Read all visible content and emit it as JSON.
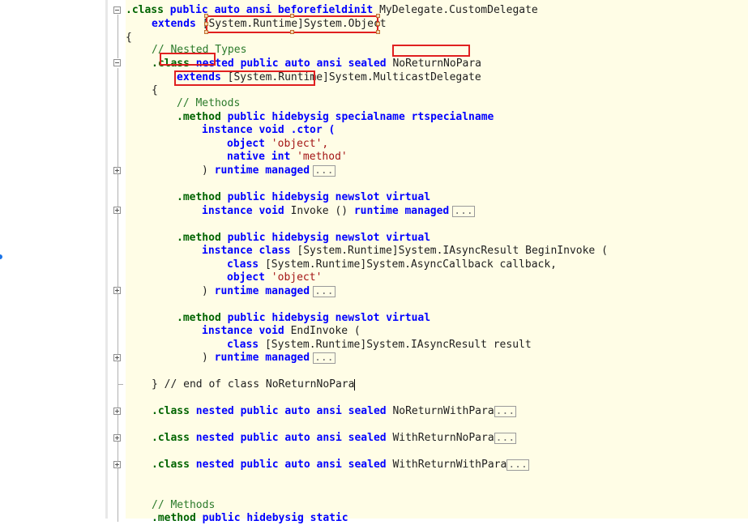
{
  "code": {
    "class_header": {
      "kw": ".class",
      "mods": "public auto ansi beforefieldinit",
      "name": "MyDelegate.CustomDelegate"
    },
    "extends_line": {
      "kw": "extends",
      "assembly": "[System.Runtime]",
      "type": "System.Object"
    },
    "open_brace": "{",
    "close_brace": "}",
    "comment_nested_types": "// Nested Types",
    "nested_class": {
      "kw": ".class",
      "mods": "nested public auto ansi sealed",
      "name": "NoReturnNoPara"
    },
    "nested_extends": {
      "kw": "extends",
      "assembly": "[System.Runtime]",
      "type": "System.MulticastDelegate"
    },
    "comment_methods": "// Methods",
    "ctor": {
      "decl_kw": ".method",
      "decl_mods": "public hidebysig specialname rtspecialname",
      "sig_kw": "instance void",
      "sig_name": ".ctor (",
      "param1_kw": "object",
      "param1_name": "'object',",
      "param2_kw": "native int",
      "param2_name": "'method'",
      "tail_paren": ")",
      "tail_kw": "runtime managed"
    },
    "invoke": {
      "decl_kw": ".method",
      "decl_mods": "public hidebysig newslot virtual",
      "sig_kw": "instance void",
      "sig_rest": "Invoke ()",
      "tail_kw": "runtime managed"
    },
    "begin_invoke": {
      "decl_kw": ".method",
      "decl_mods": "public hidebysig newslot virtual",
      "sig_kw": "instance class",
      "sig_rest": "[System.Runtime]System.IAsyncResult BeginInvoke (",
      "param1_kw": "class",
      "param1_name": "[System.Runtime]System.AsyncCallback callback,",
      "param2_kw": "object",
      "param2_name": "'object'",
      "tail_paren": ")",
      "tail_kw": "runtime managed"
    },
    "end_invoke": {
      "decl_kw": ".method",
      "decl_mods": "public hidebysig newslot virtual",
      "sig_kw": "instance void",
      "sig_rest": "EndInvoke (",
      "param1_kw": "class",
      "param1_name": "[System.Runtime]System.IAsyncResult result",
      "tail_paren": ")",
      "tail_kw": "runtime managed"
    },
    "end_of_class": "} // end of class NoReturnNoPara",
    "collapsed_classes": [
      {
        "kw": ".class",
        "mods": "nested public auto ansi sealed",
        "name": "NoReturnWithPara"
      },
      {
        "kw": ".class",
        "mods": "nested public auto ansi sealed",
        "name": "WithReturnNoPara"
      },
      {
        "kw": ".class",
        "mods": "nested public auto ansi sealed",
        "name": "WithReturnWithPara"
      }
    ],
    "comment_methods_outer": "// Methods",
    "last_method": {
      "decl_kw": ".method",
      "decl_mods": "public hidebysig static"
    },
    "ellipsis": "..."
  },
  "colors": {
    "editor_bg": "#fffde6",
    "keyword": "#0000ff",
    "directive": "#006400",
    "comment": "#2b7a2b",
    "string": "#a31515",
    "annotation": "#e02020"
  }
}
